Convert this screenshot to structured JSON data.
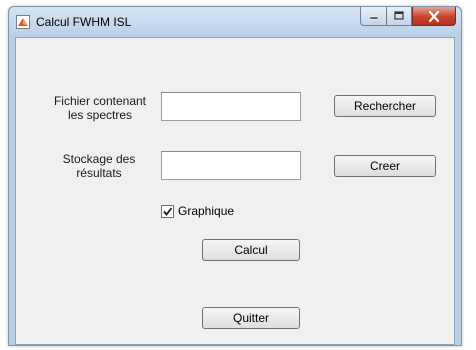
{
  "window": {
    "title": "Calcul FWHM ISL",
    "icon": "matlab-figure-icon",
    "controls": {
      "minimize": "minimize-icon",
      "maximize": "maximize-icon",
      "close": "close-icon"
    }
  },
  "form": {
    "spectra_label": "Fichier contenant les spectres",
    "spectra_value": "",
    "browse_button": "Rechercher",
    "results_label": "Stockage des résultats",
    "results_value": "",
    "create_button": "Creer",
    "graph_checkbox_label": "Graphique",
    "graph_checked": true,
    "compute_button": "Calcul",
    "quit_button": "Quitter"
  },
  "colors": {
    "frame": "#b9cfe6",
    "client_bg": "#f0f0f0",
    "close_button": "#c8442b"
  }
}
